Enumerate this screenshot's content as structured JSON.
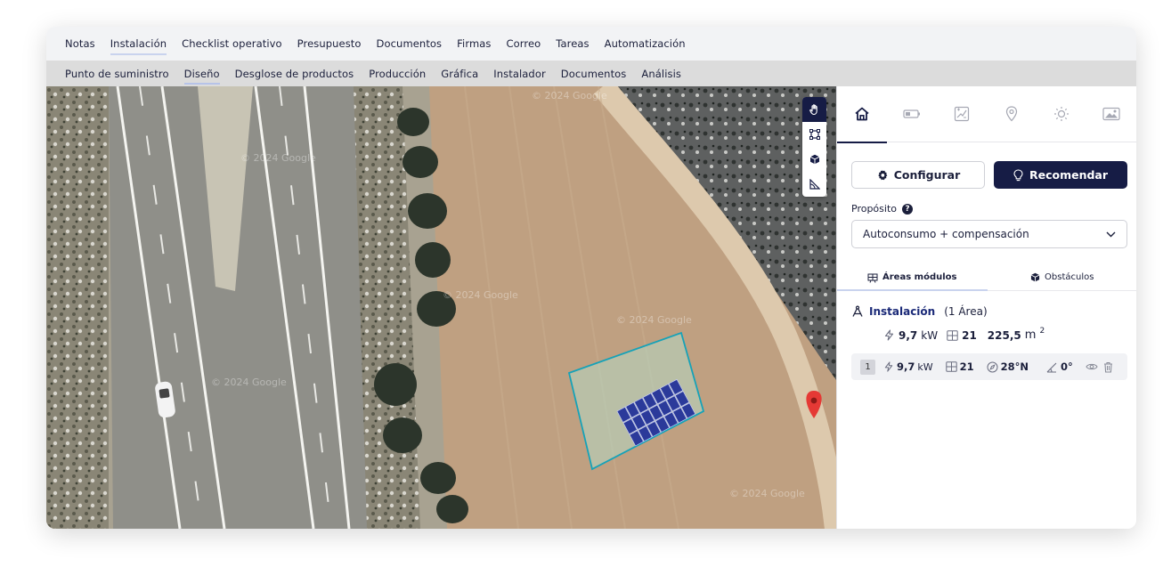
{
  "top_tabs": [
    {
      "label": "Notas"
    },
    {
      "label": "Instalación",
      "active": true
    },
    {
      "label": "Checklist operativo"
    },
    {
      "label": "Presupuesto"
    },
    {
      "label": "Documentos"
    },
    {
      "label": "Firmas"
    },
    {
      "label": "Correo"
    },
    {
      "label": "Tareas"
    },
    {
      "label": "Automatización"
    }
  ],
  "sub_tabs": [
    {
      "label": "Punto de suministro"
    },
    {
      "label": "Diseño",
      "active": true
    },
    {
      "label": "Desglose de productos"
    },
    {
      "label": "Producción"
    },
    {
      "label": "Gráfica"
    },
    {
      "label": "Instalador"
    },
    {
      "label": "Documentos"
    },
    {
      "label": "Análisis"
    }
  ],
  "map": {
    "watermarks": [
      "© 2024 Google",
      "© 2024 Google",
      "© 2024 Google",
      "© 2024 Google",
      "© 2024 Google",
      "© 2024 Google"
    ],
    "tools": [
      "hand-pan-tool-icon",
      "draw-area-tool-icon",
      "obstacle-cube-tool-icon",
      "measure-angle-tool-icon"
    ]
  },
  "panel": {
    "icons": [
      "home-icon",
      "battery-icon",
      "chart-icon",
      "location-pin-icon",
      "sun-icon",
      "image-icon"
    ],
    "configure_label": "Configurar",
    "recommend_label": "Recomendar",
    "purpose_label": "Propósito",
    "help_glyph": "?",
    "purpose_value": "Autoconsumo + compensación",
    "subtab_modules": "Áreas módulos",
    "subtab_obstacles": "Obstáculos",
    "installation": {
      "name": "Instalación",
      "count": "(1 Área)",
      "power": "9,7",
      "power_unit": "kW",
      "modules": "21",
      "area": "225,5",
      "area_unit": "m",
      "area_exp": "2"
    },
    "area_row": {
      "index": "1",
      "power": "9,7",
      "power_unit": "kW",
      "modules": "21",
      "orientation": "28°N",
      "tilt": "0°"
    }
  },
  "colors": {
    "navy": "#161c45",
    "area_outline": "#16a2b8",
    "solar_panel": "#2b3a9a",
    "pin": "#e53935"
  }
}
